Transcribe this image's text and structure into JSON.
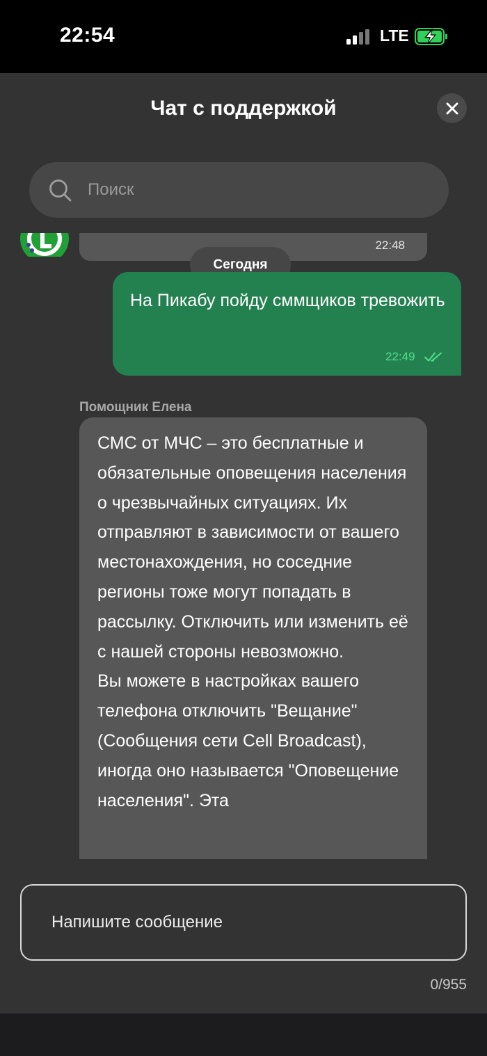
{
  "status_bar": {
    "time": "22:54",
    "network": "LTE",
    "icons": [
      "signal-icon",
      "battery-charging-icon"
    ],
    "battery_fill": 0.75
  },
  "header": {
    "title": "Чат с поддержкой",
    "close_icon": "close-icon"
  },
  "search": {
    "placeholder": "Поиск",
    "icon": "search-icon"
  },
  "chat": {
    "previous_message_time": "22:48",
    "date_separator": "Сегодня",
    "outgoing": {
      "text": "На Пикабу пойду сммщиков тревожить",
      "time": "22:49",
      "status_icon": "double-check-icon"
    },
    "incoming": {
      "sender": "Помощник Елена",
      "text": "СМС от МЧС – это бесплатные и обязательные оповещения населения о чрезвычайных ситуациях. Их отправляют в зависимости от вашего местонахождения, но соседние регионы тоже могут попадать в рассылку. Отключить или изменить её с нашей стороны невозможно.\nВы можете в настройках вашего телефона отключить \"Вещание\" (Сообщения сети Cell Broadcast), иногда оно называется \"Оповещение населения\". Эта"
    }
  },
  "composer": {
    "placeholder": "Напишите сообщение",
    "counter": "0/955"
  },
  "colors": {
    "panel": "#333333",
    "outgoing_bubble": "#238150",
    "incoming_bubble": "#575757",
    "accent": "#21a038"
  }
}
